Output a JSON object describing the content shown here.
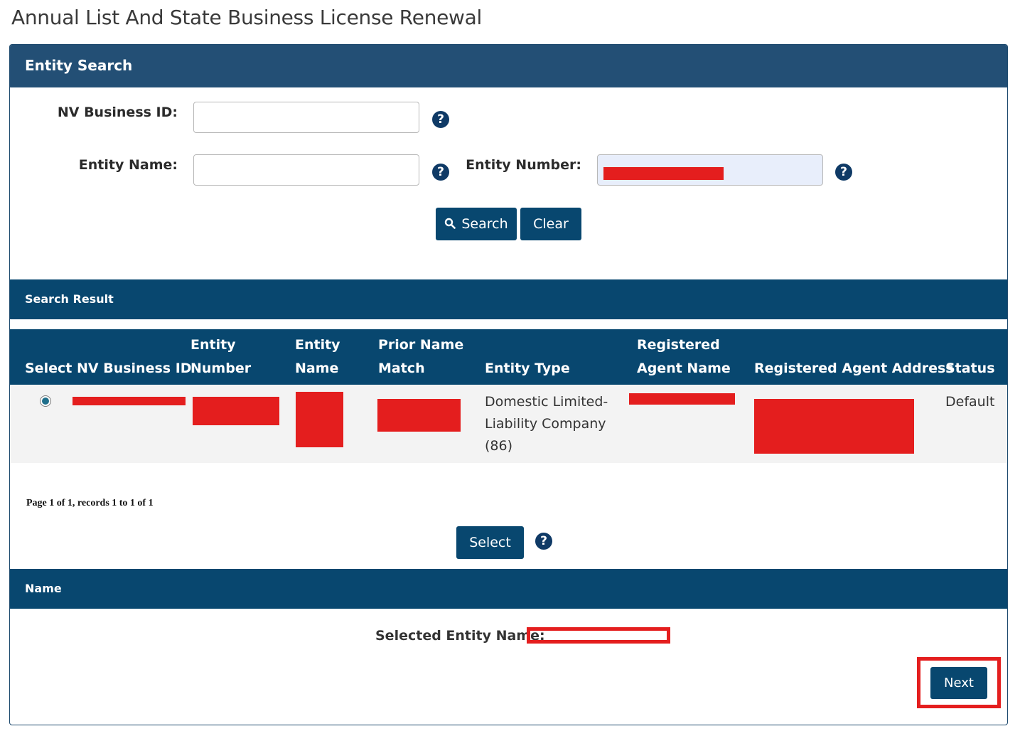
{
  "page": {
    "title": "Annual List And State Business License Renewal"
  },
  "entity_search": {
    "header": "Entity Search",
    "nv_business_id_label": "NV Business ID:",
    "nv_business_id_value": "",
    "entity_name_label": "Entity Name:",
    "entity_name_value": "",
    "entity_number_label": "Entity Number:",
    "help_glyph": "?",
    "search_button": "Search",
    "clear_button": "Clear"
  },
  "search_result": {
    "header": "Search Result",
    "columns": [
      "Select",
      "NV Business ID",
      "Entity\nNumber",
      "Entity\nName",
      "Prior Name\nMatch",
      "Entity Type",
      "Registered\nAgent Name",
      "Registered Agent Address",
      "Status"
    ],
    "rows": [
      {
        "selected": true,
        "entity_type": "Domestic Limited-Liability Company (86)",
        "status": "Default"
      }
    ],
    "pager": "Page 1 of 1, records 1 to 1 of 1",
    "select_button": "Select"
  },
  "name_section": {
    "header": "Name",
    "selected_entity_label": "Selected Entity Name:",
    "next_button": "Next"
  },
  "colors": {
    "header_bar": "#08476f",
    "entity_search_bar": "#234f75",
    "redaction": "#e41e1e",
    "highlight_outline": "#e41e1e"
  }
}
